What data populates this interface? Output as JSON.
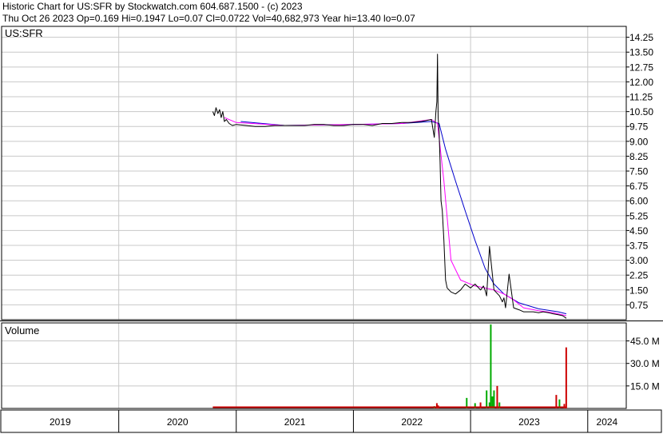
{
  "header": {
    "line1": "Historic Chart for US:SFR by Stockwatch.com 604.687.1500 - (c) 2023",
    "line2": "Thu Oct 26 2023   Op=0.169   Hi=0.1947   Lo=0.07   Cl=0.0722   Vol=40,682,973   Year hi=13.40   lo=0.07"
  },
  "colors": {
    "price_line": "#000000",
    "ma_short": "#ff00ff",
    "ma_long": "#0000cc",
    "volume_up": "#00aa00",
    "volume_down": "#cc0000",
    "grid": "#c8c8c8"
  },
  "chart_data": [
    {
      "type": "line",
      "title": "US:SFR",
      "x_axis": {
        "labels": [
          "2019",
          "2020",
          "2021",
          "2022",
          "2023",
          "2024"
        ],
        "year_start_dates": [
          "2019-01-01",
          "2020-01-01",
          "2021-01-01",
          "2022-01-01",
          "2023-01-01",
          "2024-01-01"
        ],
        "range": [
          "2019-01-01",
          "2024-04-30"
        ]
      },
      "y_axis": {
        "ticks": [
          "0.75",
          "1.50",
          "2.25",
          "3.00",
          "3.75",
          "4.50",
          "5.25",
          "6.00",
          "6.75",
          "7.50",
          "8.25",
          "9.00",
          "9.75",
          "10.50",
          "11.25",
          "12.00",
          "12.75",
          "13.50",
          "14.25"
        ],
        "range": [
          0,
          14.8
        ],
        "grid": true
      },
      "series": [
        {
          "role": "price",
          "x": [
            "2020-10-20",
            "2020-10-25",
            "2020-10-30",
            "2020-11-05",
            "2020-11-10",
            "2020-11-15",
            "2020-11-20",
            "2020-11-25",
            "2020-12-01",
            "2020-12-10",
            "2020-12-20",
            "2021-01-01",
            "2021-02-01",
            "2021-03-01",
            "2021-04-01",
            "2021-05-01",
            "2021-06-01",
            "2021-07-01",
            "2021-08-01",
            "2021-09-01",
            "2021-10-01",
            "2021-11-01",
            "2021-12-01",
            "2022-01-01",
            "2022-02-01",
            "2022-03-01",
            "2022-04-01",
            "2022-05-01",
            "2022-06-01",
            "2022-07-01",
            "2022-08-01",
            "2022-09-01",
            "2022-09-10",
            "2022-09-15",
            "2022-09-18",
            "2022-09-20",
            "2022-09-22",
            "2022-09-25",
            "2022-09-28",
            "2022-10-01",
            "2022-10-05",
            "2022-10-10",
            "2022-10-15",
            "2022-10-20",
            "2022-11-01",
            "2022-11-15",
            "2022-12-01",
            "2022-12-15",
            "2023-01-01",
            "2023-01-15",
            "2023-02-01",
            "2023-02-10",
            "2023-02-15",
            "2023-02-20",
            "2023-03-01",
            "2023-03-15",
            "2023-04-01",
            "2023-04-10",
            "2023-04-15",
            "2023-04-20",
            "2023-05-01",
            "2023-05-15",
            "2023-06-01",
            "2023-06-15",
            "2023-07-01",
            "2023-07-15",
            "2023-08-01",
            "2023-08-15",
            "2023-09-01",
            "2023-09-15",
            "2023-10-01",
            "2023-10-15",
            "2023-10-26"
          ],
          "values": [
            10.5,
            10.3,
            10.7,
            10.4,
            10.6,
            10.2,
            10.5,
            10.0,
            10.1,
            9.9,
            9.8,
            9.85,
            9.8,
            9.75,
            9.75,
            9.8,
            9.8,
            9.8,
            9.8,
            9.85,
            9.85,
            9.8,
            9.8,
            9.85,
            9.85,
            9.8,
            9.9,
            9.9,
            9.95,
            9.95,
            10.0,
            10.1,
            9.2,
            10.5,
            11.0,
            13.4,
            10.2,
            9.5,
            8.0,
            6.0,
            5.5,
            4.0,
            2.0,
            1.6,
            1.4,
            1.3,
            1.5,
            1.8,
            1.6,
            1.8,
            1.5,
            1.7,
            1.5,
            1.2,
            3.7,
            1.5,
            1.2,
            0.9,
            1.1,
            0.6,
            2.3,
            0.6,
            0.5,
            0.4,
            0.4,
            0.4,
            0.35,
            0.4,
            0.35,
            0.3,
            0.25,
            0.2,
            0.0722
          ]
        },
        {
          "role": "ma_short",
          "x": [
            "2020-11-25",
            "2021-01-01",
            "2021-06-01",
            "2022-01-01",
            "2022-06-01",
            "2022-09-01",
            "2022-09-20",
            "2022-10-10",
            "2022-11-01",
            "2022-12-01",
            "2023-01-15",
            "2023-02-15",
            "2023-03-15",
            "2023-04-15",
            "2023-05-15",
            "2023-06-15",
            "2023-08-01",
            "2023-09-15",
            "2023-10-26"
          ],
          "values": [
            10.2,
            9.95,
            9.8,
            9.85,
            9.9,
            10.1,
            9.9,
            7.0,
            3.0,
            2.0,
            1.7,
            1.6,
            1.5,
            1.3,
            1.0,
            0.6,
            0.45,
            0.35,
            0.2
          ]
        },
        {
          "role": "ma_long",
          "x": [
            "2021-01-15",
            "2021-06-01",
            "2022-01-01",
            "2022-06-01",
            "2022-09-01",
            "2022-09-25",
            "2022-10-15",
            "2022-11-15",
            "2022-12-15",
            "2023-01-15",
            "2023-02-15",
            "2023-03-15",
            "2023-04-15",
            "2023-06-01",
            "2023-08-01",
            "2023-10-01",
            "2023-10-26"
          ],
          "values": [
            10.0,
            9.8,
            9.85,
            9.9,
            10.0,
            9.9,
            8.6,
            7.0,
            5.5,
            4.0,
            2.6,
            1.8,
            1.3,
            0.85,
            0.55,
            0.4,
            0.3
          ]
        }
      ]
    },
    {
      "type": "bar",
      "title": "Volume",
      "y_axis": {
        "ticks": [
          "15.0 M",
          "30.0 M",
          "45.0 M"
        ],
        "range": [
          0,
          57
        ],
        "unit": "M"
      },
      "spikes": {
        "x": [
          "2022-09-10",
          "2022-09-18",
          "2022-09-22",
          "2022-12-20",
          "2023-01-15",
          "2023-02-01",
          "2023-02-20",
          "2023-03-01",
          "2023-03-05",
          "2023-03-10",
          "2023-03-15",
          "2023-03-25",
          "2023-04-01",
          "2023-09-25",
          "2023-10-05",
          "2023-10-20",
          "2023-10-26"
        ],
        "values": [
          1.5,
          3.5,
          2.0,
          7.0,
          3.5,
          4.0,
          12.0,
          4.0,
          56.0,
          8.0,
          12.0,
          15.0,
          4.0,
          9.0,
          6.0,
          3.0,
          40.7
        ],
        "direction": [
          "up",
          "down",
          "down",
          "up",
          "up",
          "down",
          "up",
          "up",
          "up",
          "up",
          "up",
          "down",
          "up",
          "down",
          "up",
          "down",
          "down"
        ]
      }
    }
  ]
}
